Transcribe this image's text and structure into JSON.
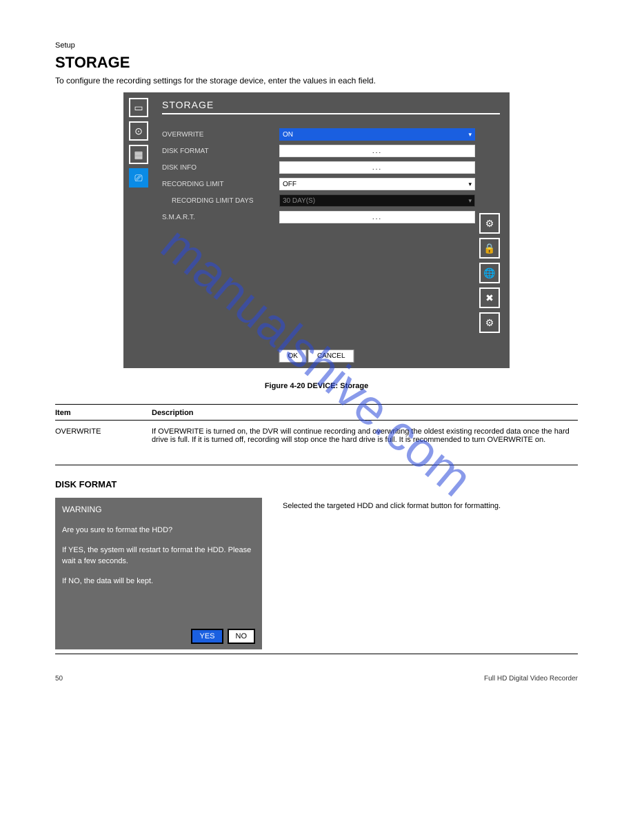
{
  "page_header_small": "Setup",
  "header_title": "STORAGE",
  "header_sub": "To configure the recording settings for the storage device, enter the values in each field.",
  "watermark": "manualshive.com",
  "screenshot": {
    "title": "STORAGE",
    "left_icons": [
      {
        "name": "sidebar-display-icon",
        "glyph": "▭"
      },
      {
        "name": "sidebar-record-icon",
        "glyph": "⊙"
      },
      {
        "name": "sidebar-device-icon",
        "glyph": "▦"
      },
      {
        "name": "sidebar-storage-icon",
        "glyph": "⎚",
        "active": true
      }
    ],
    "rows": [
      {
        "label": "OVERWRITE",
        "value": "ON",
        "style": "blue",
        "dd": true
      },
      {
        "label": "DISK FORMAT",
        "value": "...",
        "style": "dots"
      },
      {
        "label": "DISK INFO",
        "value": "...",
        "style": "dots"
      },
      {
        "label": "RECORDING LIMIT",
        "value": "OFF",
        "style": "plain",
        "dd": true
      },
      {
        "label": "RECORDING LIMIT DAYS",
        "value": "30 DAY(S)",
        "style": "dark",
        "dd": true,
        "indent": true
      },
      {
        "label": "S.M.A.R.T.",
        "value": "...",
        "style": "dots"
      }
    ],
    "right_icons": [
      {
        "name": "right-gears-icon",
        "glyph": "⚙"
      },
      {
        "name": "right-lock-icon",
        "glyph": "🔒"
      },
      {
        "name": "right-network-icon",
        "glyph": "🌐"
      },
      {
        "name": "right-tools-icon",
        "glyph": "✖"
      },
      {
        "name": "right-search-icon",
        "glyph": "⚙"
      }
    ],
    "ok": "OK",
    "cancel": "CANCEL"
  },
  "figno": "Figure 4-20 DEVICE: Storage",
  "table": {
    "h1": "Item",
    "h2": "Description",
    "r1c1": "OVERWRITE",
    "r1c2": "If OVERWRITE is turned on, the DVR will continue recording and overwriting the oldest existing recorded data once the hard drive is full. If it is turned off, recording will stop once the hard drive is full. It is recommended to turn OVERWRITE on."
  },
  "disk_format_title": "DISK FORMAT",
  "warning": {
    "title": "WARNING",
    "line1": "Are you sure to format the HDD?",
    "line2": "If YES, the system will restart to format the HDD. Please wait a few seconds.",
    "line3": "If NO, the data will be kept.",
    "yes": "YES",
    "no": "NO",
    "side_text": "Selected the targeted HDD and click format button for formatting."
  },
  "footer_left": "50",
  "footer_right": "Full HD Digital Video Recorder"
}
